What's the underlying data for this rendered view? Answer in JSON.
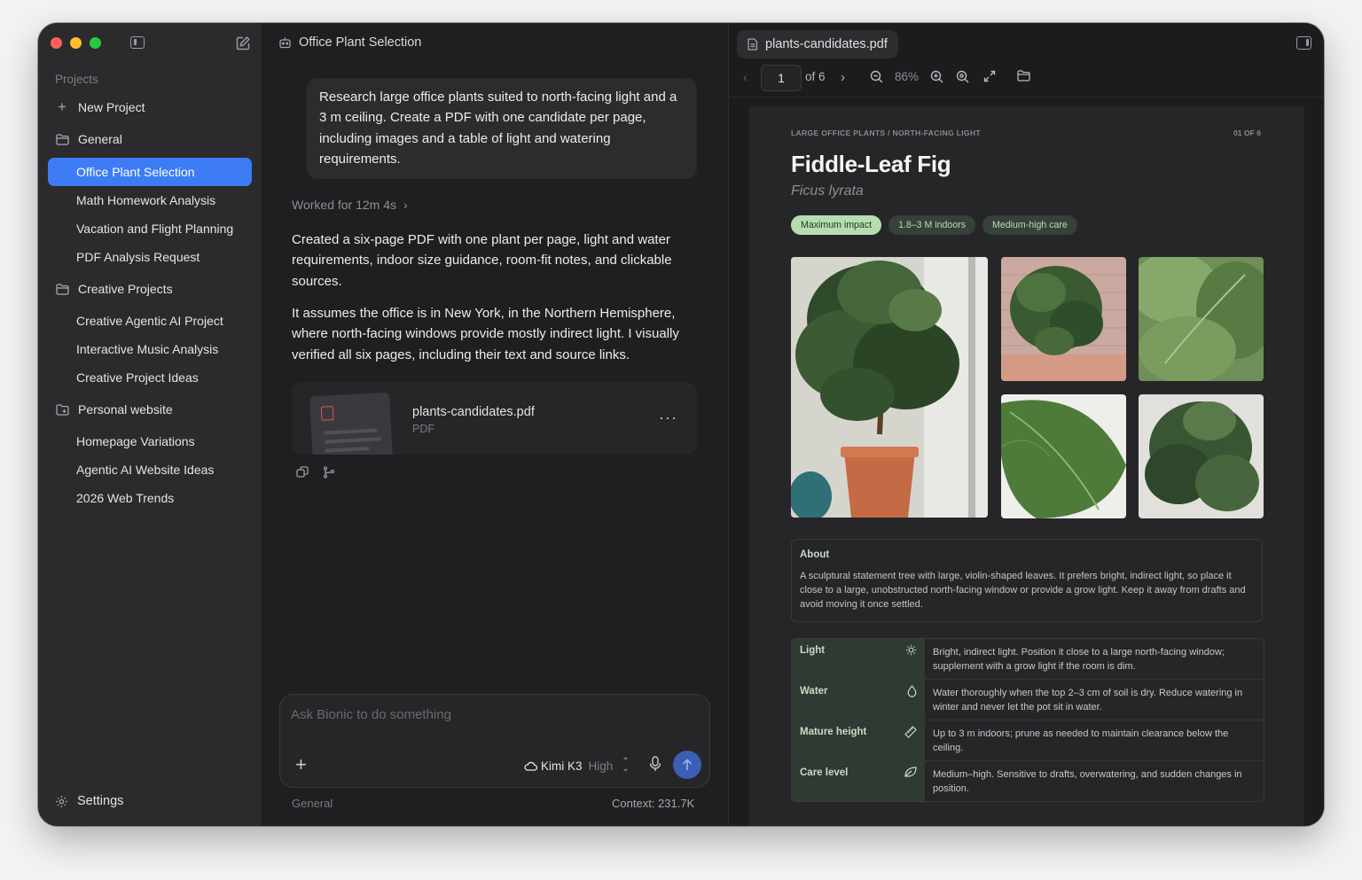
{
  "sidebar": {
    "section_label": "Projects",
    "new_project": "New Project",
    "groups": [
      {
        "label": "General",
        "icon": "folder-icon",
        "items": [
          "Office Plant Selection",
          "Math Homework Analysis",
          "Vacation and Flight Planning",
          "PDF Analysis Request"
        ]
      },
      {
        "label": "Creative Projects",
        "icon": "folder-icon",
        "items": [
          "Creative Agentic AI Project",
          "Interactive Music Analysis",
          "Creative Project Ideas"
        ]
      },
      {
        "label": "Personal website",
        "icon": "folder-sparkle-icon",
        "items": [
          "Homepage Variations",
          "Agentic AI Website Ideas",
          "2026 Web Trends"
        ]
      }
    ],
    "active_item": "Office Plant Selection",
    "settings": "Settings"
  },
  "chat": {
    "title": "Office Plant Selection",
    "user_message": "Research large office plants suited to north-facing light and a 3 m ceiling. Create a PDF with one candidate per page, including images and a table of light and watering requirements.",
    "worked_for": "Worked for 12m 4s",
    "reply_1": "Created a six-page PDF with one plant per page, light and water requirements, indoor size guidance, room-fit notes, and clickable sources.",
    "reply_2": "It assumes the office is in New York, in the Northern Hemisphere, where north-facing windows provide mostly indirect light. I visually verified all six pages, including their text and source links.",
    "attachment": {
      "name": "plants-candidates.pdf",
      "type": "PDF"
    },
    "composer_placeholder": "Ask Bionic to do something",
    "model": "Kimi K3",
    "model_level": "High",
    "footer_project": "General",
    "footer_context": "Context: 231.7K"
  },
  "viewer": {
    "tab": "plants-candidates.pdf",
    "page_current": "1",
    "page_total": "of 6",
    "zoom": "86%",
    "page": {
      "eyebrow": "LARGE OFFICE PLANTS / NORTH-FACING LIGHT",
      "page_label": "01 OF 6",
      "title": "Fiddle-Leaf Fig",
      "subtitle": "Ficus lyrata",
      "badges": [
        "Maximum impact",
        "1.8–3 M indoors",
        "Medium-high care"
      ],
      "about_heading": "About",
      "about_text": "A sculptural statement tree with large, violin-shaped leaves. It prefers bright, indirect light, so place it close to a large, unobstructed north-facing window or provide a grow light. Keep it away from drafts and avoid moving it once settled.",
      "care": [
        {
          "label": "Light",
          "icon": "sun-icon",
          "text": "Bright, indirect light. Position it close to a large north-facing window; supplement with a grow light if the room is dim."
        },
        {
          "label": "Water",
          "icon": "droplet-icon",
          "text": "Water thoroughly when the top 2–3 cm of soil is dry. Reduce watering in winter and never let the pot sit in water."
        },
        {
          "label": "Mature height",
          "icon": "ruler-icon",
          "text": "Up to 3 m indoors; prune as needed to maintain clearance below the ceiling."
        },
        {
          "label": "Care level",
          "icon": "leaf-icon",
          "text": "Medium–high. Sensitive to drafts, overwatering, and sudden changes in position."
        }
      ]
    }
  },
  "colors": {
    "accent": "#3d7cf5",
    "badge_primary": "#b6ddb0",
    "table_key_bg": "#2f3a32"
  }
}
